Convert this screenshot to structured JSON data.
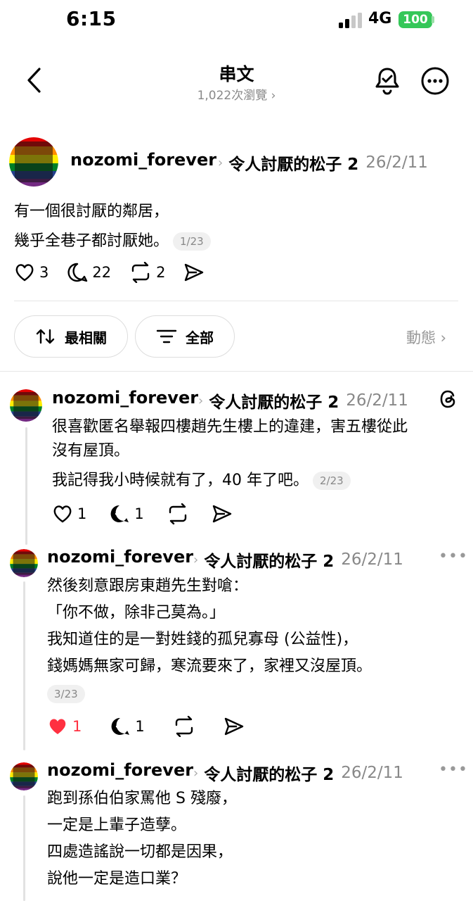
{
  "status": {
    "time": "6:15",
    "network": "4G",
    "battery": "100"
  },
  "header": {
    "title": "串文",
    "views": "1,022次瀏覽 ›"
  },
  "main_post": {
    "username": "nozomi_forever",
    "category": "令人討厭的松子 2",
    "date": "26/2/11",
    "lines": [
      "有一個很討厭的鄰居，",
      "幾乎全巷子都討厭她。"
    ],
    "pager": "1/23",
    "likes": "3",
    "comments": "22",
    "reposts": "2"
  },
  "filters": {
    "sort_label": "最相關",
    "filter_label": "全部",
    "activity_label": "動態 ›"
  },
  "replies": [
    {
      "username": "nozomi_forever",
      "category": "令人討厭的松子 2",
      "date": "26/2/11",
      "lines": [
        "很喜歡匿名舉報四樓趙先生樓上的違建，害五樓從此",
        "沒有屋頂。"
      ],
      "line2": "我記得我小時候就有了，40 年了吧。",
      "pager": "2/23",
      "likes": "1",
      "comments": "1"
    },
    {
      "username": "nozomi_forever",
      "category": "令人討厭的松子 2",
      "date": "26/2/11",
      "lines": [
        "然後刻意跟房東趙先生對嗆：",
        "「你不做，除非己莫為。」",
        "我知道住的是一對姓錢的孤兒寡母 (公益性)，",
        "錢媽媽無家可歸，寒流要來了，家裡又沒屋頂。"
      ],
      "pager": "3/23",
      "likes": "1",
      "comments": "1"
    },
    {
      "username": "nozomi_forever",
      "category": "令人討厭的松子 2",
      "date": "26/2/11",
      "lines": [
        "跑到孫伯伯家罵他 S 殘廢，",
        "一定是上輩子造孽。",
        "四處造謠說一切都是因果，",
        "說他一定是造口業？"
      ]
    }
  ],
  "colors": {
    "like_red": "#ff3040",
    "battery_green": "#35c759",
    "muted": "#888888"
  }
}
